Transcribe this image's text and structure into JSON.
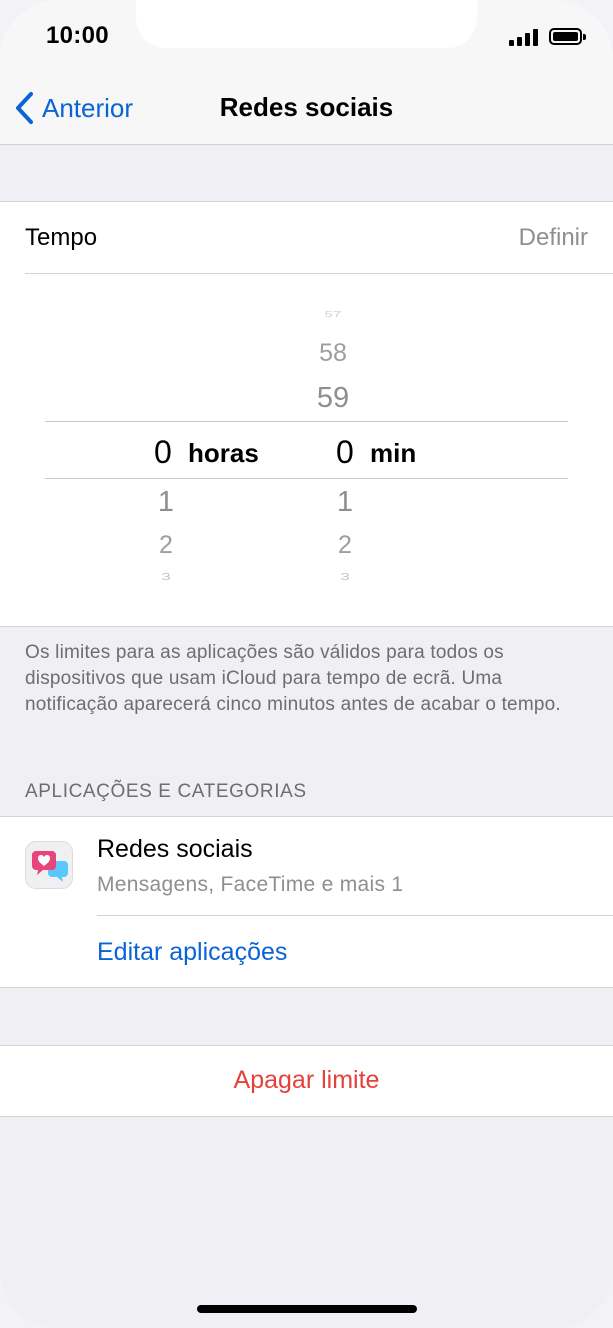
{
  "status_bar": {
    "time": "10:00"
  },
  "nav": {
    "back_label": "Anterior",
    "title": "Redes sociais"
  },
  "tempo": {
    "label": "Tempo",
    "value": "Definir"
  },
  "picker": {
    "hours": {
      "above": [],
      "selected": "0",
      "unit": "horas",
      "below": [
        "1",
        "2",
        "3"
      ]
    },
    "minutes": {
      "above": [
        "57",
        "58",
        "59"
      ],
      "selected": "0",
      "unit": "min",
      "below": [
        "1",
        "2",
        "3"
      ]
    }
  },
  "footer_text": "Os limites para as aplicações são válidos para todos os dispositivos que usam iCloud para tempo de ecrã. Uma notificação aparecerá cinco minutos antes de acabar o tempo.",
  "section_header": "APLICAÇÕES E CATEGORIAS",
  "app_group": {
    "title": "Redes sociais",
    "subtitle": "Mensagens, FaceTime e mais 1",
    "icon": "social-chat-bubbles-icon",
    "edit_label": "Editar aplicações"
  },
  "delete_label": "Apagar limite",
  "colors": {
    "accent": "#0a64d6",
    "destructive": "#e5413b",
    "icon_pink": "#e8457a",
    "icon_blue": "#5ac8fa"
  }
}
